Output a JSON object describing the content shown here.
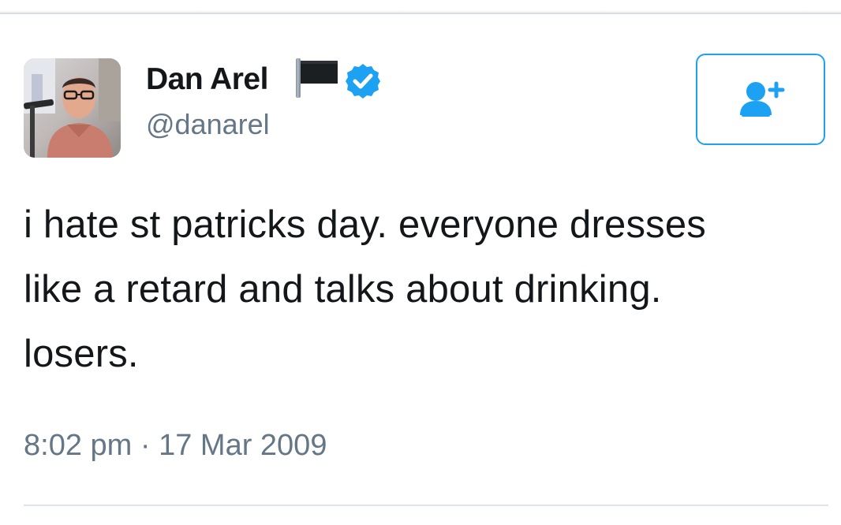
{
  "tweet": {
    "author": {
      "display_name": "Dan Arel",
      "handle": "@danarel",
      "verified": true,
      "badge_icon": "black-flag-icon",
      "verified_icon": "verified-badge-icon",
      "avatar_icon": "profile-photo"
    },
    "follow_button": {
      "icon": "add-user-icon",
      "accent_color": "#1da1f2"
    },
    "text_lines": [
      "i hate st patricks day. everyone dresses",
      "like a retard and talks about drinking.",
      "losers."
    ],
    "time": "8:02 pm",
    "separator": "·",
    "date": "17 Mar 2009"
  },
  "colors": {
    "text_primary": "#14171a",
    "text_secondary": "#657786",
    "accent": "#1da1f2",
    "divider": "#dfe4e8"
  }
}
